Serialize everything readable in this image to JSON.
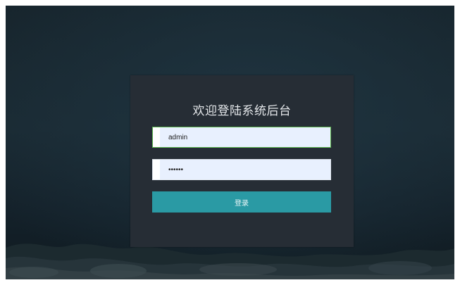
{
  "login": {
    "title": "欢迎登陆系统后台",
    "username_value": "admin",
    "password_value": "123456",
    "submit_label": "登录"
  },
  "colors": {
    "background": "#17252d",
    "panel": "#262d35",
    "input_bg": "#e8f0fe",
    "input_focus_border": "#57b24a",
    "button": "#2a9aa4"
  }
}
